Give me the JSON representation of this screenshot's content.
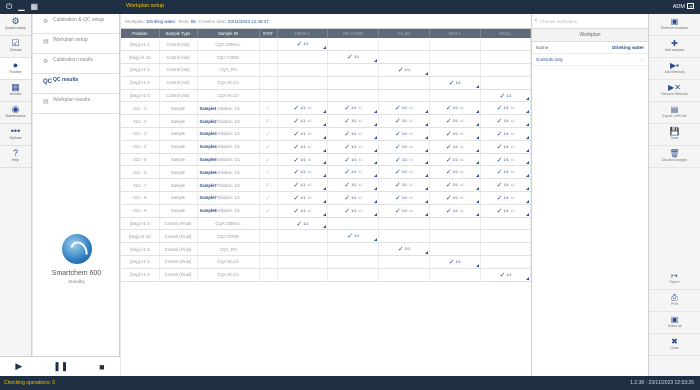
{
  "app": {
    "window_title": "Workplan setup",
    "user": "ADM",
    "status_left": "Checking operations: 0",
    "status_right": "1.2.38 · 23/11/2023 12:53:26"
  },
  "left_nav": [
    {
      "icon": "gear-icon",
      "glyph": "⚙",
      "label": "System setup",
      "active": false
    },
    {
      "icon": "checkbox-icon",
      "glyph": "☑",
      "label": "Checks",
      "active": false
    },
    {
      "icon": "drop-icon",
      "glyph": "●",
      "label": "Routine",
      "active": true
    },
    {
      "icon": "grid-icon",
      "glyph": "▦",
      "label": "Archive",
      "active": false
    },
    {
      "icon": "disc-icon",
      "glyph": "◉",
      "label": "Maintenance",
      "active": false
    },
    {
      "icon": "dots-icon",
      "glyph": "•••",
      "label": "Options",
      "active": false
    },
    {
      "icon": "help-icon",
      "glyph": "?",
      "label": "Help",
      "active": false
    }
  ],
  "sub_menu": [
    {
      "icon": "gear-icon",
      "glyph": "⚙",
      "label": "Calibration & QC setup",
      "selected": false
    },
    {
      "icon": "document-icon",
      "glyph": "▤",
      "label": "Workplan setup",
      "selected": false
    },
    {
      "icon": "gear-icon",
      "glyph": "⚙",
      "label": "Calibration results",
      "selected": false
    },
    {
      "icon": "qc-icon",
      "glyph": "QC",
      "label": "QC results",
      "selected": true
    },
    {
      "icon": "document-icon",
      "glyph": "▤",
      "label": "Workplan results",
      "selected": false
    }
  ],
  "instrument": {
    "name": "Smartchem 600",
    "state": "Standby"
  },
  "info_bar": {
    "workplan_label": "Workplan:",
    "workplan_value": "Drinking water",
    "tests_label": "Tests:",
    "tests_value": "55",
    "date_label": "Creation date:",
    "date_value": "23/11/2023 12:49:37"
  },
  "table": {
    "headers": [
      "Position",
      "Sample Type",
      "Sample ID",
      "STAT",
      "CBNH.L",
      "NH COND",
      "CA pH",
      "NH4.L",
      "NO3.L"
    ],
    "rows": [
      {
        "position": "[Seg] A1-2",
        "type": "Control (Init)",
        "sid": "CQA CBNH.L",
        "dil": "",
        "col": 0
      },
      {
        "position": "[Seg] A1-10",
        "type": "Control (Init)",
        "sid": "CQA COND",
        "dil": "",
        "col": 1
      },
      {
        "position": "[Seg] A1-3",
        "type": "Control (Init)",
        "sid": "CQA_PH",
        "dil": "",
        "col": 2
      },
      {
        "position": "[Seg] A1-3",
        "type": "Control (Init)",
        "sid": "CQA NI.LO",
        "dil": "",
        "col": 3
      },
      {
        "position": "[Seg] A1-3",
        "type": "Control (Init)",
        "sid": "CQA NI.LO",
        "dil": "",
        "col": 4
      },
      {
        "position": "S12 - 1",
        "type": "Sample",
        "sid": "Sample1",
        "dil": "Dilution: 1/1",
        "col": -1
      },
      {
        "position": "S12 - 2",
        "type": "Sample",
        "sid": "Sample2",
        "dil": "Dilution: 1/1",
        "col": -1
      },
      {
        "position": "S12 - 3",
        "type": "Sample",
        "sid": "Sample3",
        "dil": "Dilution: 1/1",
        "col": -1
      },
      {
        "position": "S12 - 4",
        "type": "Sample",
        "sid": "Sample4",
        "dil": "Dilution: 1/1",
        "col": -1
      },
      {
        "position": "S12 - 5",
        "type": "Sample",
        "sid": "Sample5",
        "dil": "Dilution: 1/1",
        "col": -1
      },
      {
        "position": "S12 - 6",
        "type": "Sample",
        "sid": "Sample6",
        "dil": "Dilution: 1/1",
        "col": -1
      },
      {
        "position": "S12 - 7",
        "type": "Sample",
        "sid": "Sample7",
        "dil": "Dilution: 1/1",
        "col": -1
      },
      {
        "position": "S12 - 8",
        "type": "Sample",
        "sid": "Sample7",
        "dil": "Dilution: 1/1",
        "col": -1
      },
      {
        "position": "S12 - 9",
        "type": "Sample",
        "sid": "Sample8",
        "dil": "Dilution: 1/1",
        "col": -1
      },
      {
        "position": "[Seg] A1-2",
        "type": "Control (Final)",
        "sid": "CQA CBNH.L",
        "dil": "",
        "col": 0
      },
      {
        "position": "[Seg] A1-10",
        "type": "Control (Final)",
        "sid": "CQA COND",
        "dil": "",
        "col": 1
      },
      {
        "position": "[Seg] A1-3",
        "type": "Control (Final)",
        "sid": "CQA_PH",
        "dil": "",
        "col": 2
      },
      {
        "position": "[Seg] A1-3",
        "type": "Control (Final)",
        "sid": "CQA NI.LO",
        "dil": "",
        "col": 3
      },
      {
        "position": "[Seg] A1-3",
        "type": "Control (Final)",
        "sid": "CQA NI.LO",
        "dil": "",
        "col": 4
      }
    ],
    "cell_value": "1/1",
    "x_value": "x1"
  },
  "right_panel": {
    "search_placeholder": "Choose workplans",
    "title": "Workplan",
    "name_label": "Name",
    "name_value": "Drinking water",
    "controls_only": "Controls only"
  },
  "right_tools": [
    {
      "icon": "workplan-icon",
      "glyph": "▣",
      "label": "Retrieve workplan"
    },
    {
      "icon": "plus-icon",
      "glyph": "✚",
      "label": "Add samples"
    },
    {
      "icon": "add-methods-icon",
      "glyph": "▶▪",
      "label": "Add Methods"
    },
    {
      "icon": "remove-methods-icon",
      "glyph": "▶✕",
      "label": "Remove Methods"
    },
    {
      "icon": "export-icon",
      "glyph": "▤",
      "label": "Export LIMS file"
    },
    {
      "icon": "save-icon",
      "glyph": "💾",
      "label": "Save"
    },
    {
      "icon": "trash-icon",
      "glyph": "🗑",
      "label": "Discard changes"
    },
    {
      "icon": "export-arrow-icon",
      "glyph": "↦",
      "label": "Export"
    },
    {
      "icon": "print-icon",
      "glyph": "⎙",
      "label": "Print"
    },
    {
      "icon": "select-icon",
      "glyph": "▣",
      "label": "Select all"
    },
    {
      "icon": "close-icon",
      "glyph": "✖",
      "label": "Close"
    }
  ],
  "controls": [
    {
      "icon": "play-icon",
      "glyph": "▶"
    },
    {
      "icon": "pause-icon",
      "glyph": "❚❚"
    },
    {
      "icon": "stop-icon",
      "glyph": "■"
    }
  ]
}
